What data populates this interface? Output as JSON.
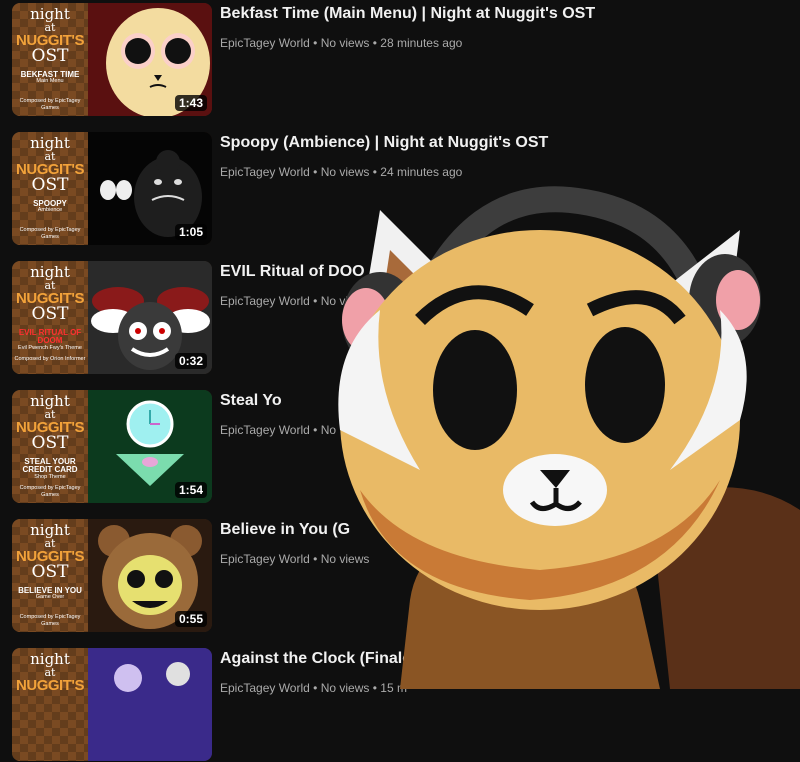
{
  "videos": [
    {
      "title": "Bekfast Time (Main Menu) | Night at Nuggit's OST",
      "channel": "EpicTagey World",
      "views": "No views",
      "age": "28 minutes ago",
      "duration": "1:43",
      "thumb": {
        "l1": "night",
        "l2": "at",
        "l3": "NUGGIT'S",
        "l4": "OST",
        "caption": "BEKFAST TIME",
        "subcaption": "Main Menu",
        "composer": "Composed by EpicTagey Games"
      }
    },
    {
      "title": "Spoopy (Ambience) | Night at Nuggit's OST",
      "channel": "EpicTagey World",
      "views": "No views",
      "age": "24 minutes ago",
      "duration": "1:05",
      "thumb": {
        "l1": "night",
        "l2": "at",
        "l3": "NUGGIT'S",
        "l4": "OST",
        "caption": "SPOOPY",
        "subcaption": "Ambience",
        "composer": "Composed by EpicTagey Games"
      }
    },
    {
      "title": "EVIL Ritual of DOO",
      "channel": "EpicTagey World",
      "views": "No vi",
      "age": "",
      "duration": "0:32",
      "thumb": {
        "l1": "night",
        "l2": "at",
        "l3": "NUGGIT'S",
        "l4": "OST",
        "caption": "EVIL RITUAL OF DOOM",
        "subcaption": "Evil Pwench Fwy's Theme",
        "composer": "Composed by Orion Informer"
      }
    },
    {
      "title": "Steal Yo",
      "channel": "EpicTagey World",
      "views": "No",
      "age": "",
      "duration": "1:54",
      "thumb": {
        "l1": "night",
        "l2": "at",
        "l3": "NUGGIT'S",
        "l4": "OST",
        "caption": "STEAL YOUR CREDIT CARD",
        "subcaption": "Shop Theme",
        "composer": "Composed by EpicTagey Games"
      }
    },
    {
      "title": "Believe in You (G",
      "channel": "EpicTagey World",
      "views": "No views",
      "age": "",
      "duration": "0:55",
      "thumb": {
        "l1": "night",
        "l2": "at",
        "l3": "NUGGIT'S",
        "l4": "OST",
        "caption": "BELIEVE IN YOU",
        "subcaption": "Game Over",
        "composer": "Composed by EpicTagey Games"
      }
    },
    {
      "title": "Against the Clock (Finale, P",
      "channel": "EpicTagey World",
      "views": "No views",
      "age": "15 m",
      "duration": "",
      "thumb": {
        "l1": "night",
        "l2": "at",
        "l3": "NUGGIT'S",
        "l4": "",
        "caption": "",
        "subcaption": "",
        "composer": ""
      }
    }
  ],
  "separator": " • ",
  "colors": {
    "bg": "#0f0f0f",
    "title": "#f1f1f1",
    "meta": "#aaaaaa",
    "orange": "#f2a23a"
  }
}
